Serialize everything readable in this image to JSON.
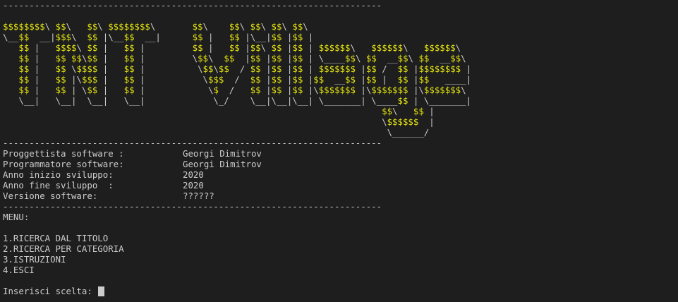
{
  "separator": "------------------------------------------------------------------------",
  "banner_art": [
    "$$$$$$$$\\ $$\\   $$\\ $$$$$$$$\\       $$\\    $$\\ $$\\ $$\\ $$\\",
    "\\__$$  __|$$$\\  $$ |\\__$$  __|      $$ |   $$ |\\__|$$ |$$ |",
    "   $$ |   $$$$\\ $$ |   $$ |         $$ |   $$ |$$\\ $$ |$$ | $$$$$$\\   $$$$$$\\   $$$$$$\\",
    "   $$ |   $$ $$\\$$ |   $$ |         \\$$\\  $$  |$$ |$$ |$$ | \\____$$\\ $$  __$$\\ $$  __$$\\",
    "   $$ |   $$ \\$$$$ |   $$ |          \\$$\\$$  / $$ |$$ |$$ | $$$$$$$ |$$ /  $$ |$$$$$$$$ |",
    "   $$ |   $$ |\\$$$ |   $$ |           \\$$$  /  $$ |$$ |$$ |$$  __$$ |$$ |  $$ |$$   ____|",
    "   $$ |   $$ | \\$$ |   $$ |            \\$  /   $$ |$$ |$$ |\\$$$$$$$ |\\$$$$$$$ |\\$$$$$$$\\",
    "   \\__|   \\__|  \\__|   \\__|             \\_/    \\__|\\__|\\__| \\_______| \\____$$ | \\_______|",
    "                                                                        $$\\   $$ |",
    "                                                                        \\$$$$$$  |",
    "                                                                         \\______/"
  ],
  "info": {
    "designer_label": "Proggettista software :",
    "designer_value": "Georgi Dimitrov",
    "programmer_label": "Programmatore software:",
    "programmer_value": "Georgi Dimitrov",
    "start_label": "Anno inizio sviluppo:",
    "start_value": "2020",
    "end_label": "Anno fine sviluppo  :",
    "end_value": "2020",
    "version_label": "Versione software:",
    "version_value": "??????"
  },
  "menu": {
    "title": "MENU:",
    "items": [
      "1.RICERCA DAL TITOLO",
      "2.RICERCA PER CATEGORIA",
      "3.ISTRUZIONI",
      "4.ESCI"
    ]
  },
  "prompt": {
    "label": "Inserisci scelta: "
  },
  "colors": {
    "background": "#1e1e1e",
    "text": "#cccccc",
    "art_dollar": "#e5e510"
  }
}
